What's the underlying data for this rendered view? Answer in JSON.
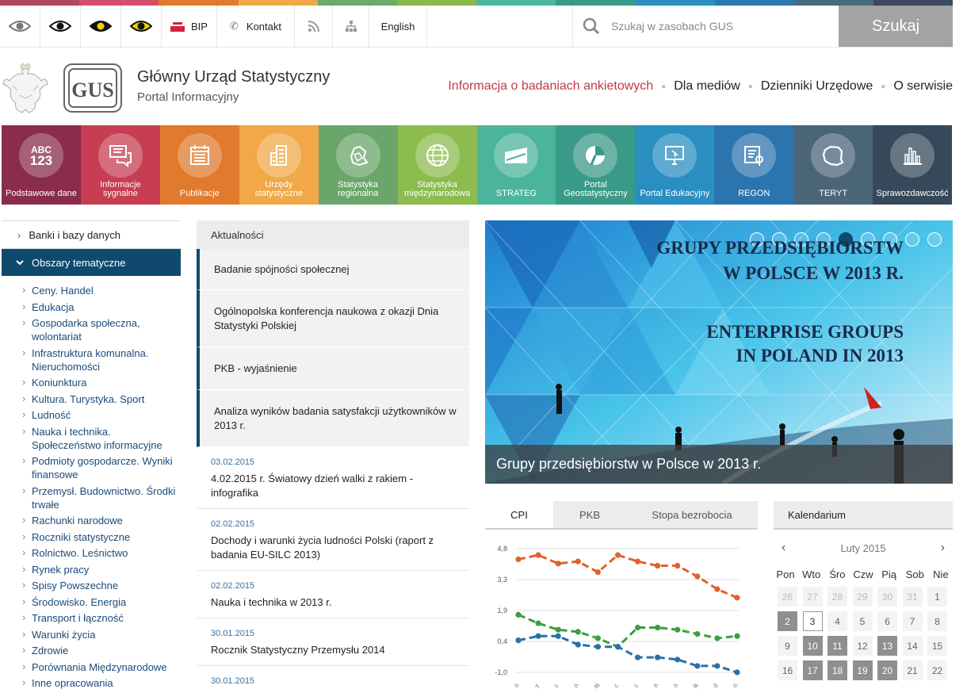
{
  "colors": {
    "strip": [
      "#b04a5a",
      "#d0506a",
      "#e07a2c",
      "#f0a84a",
      "#6aaa6a",
      "#8ab84a",
      "#4ab8a0",
      "#3a9a8a",
      "#2a90c0",
      "#2a78b0",
      "#4a6a80",
      "#3a4a5a"
    ],
    "tiles": [
      "#8a2d4a",
      "#c73e52",
      "#e07a2c",
      "#f0a848",
      "#6aa66a",
      "#8cbb4e",
      "#4bb49c",
      "#3a9a88",
      "#2a8ec0",
      "#2c74ae",
      "#4a6578",
      "#35495a"
    ],
    "accent_red": "#c0394a",
    "nav_blue": "#0f4a6e",
    "cpi": "#e0622a",
    "series2": "#3aa040",
    "series3": "#2a70a8"
  },
  "topbar": {
    "bip_label": "BIP",
    "kontakt_label": "Kontakt",
    "english_label": "English",
    "search_placeholder": "Szukaj w zasobach GUS",
    "search_button": "Szukaj"
  },
  "header": {
    "logo_text": "GUS",
    "title": "Główny Urząd Statystyczny",
    "subtitle": "Portal Informacyjny",
    "nav": [
      "Informacja o badaniach ankietowych",
      "Dla mediów",
      "Dzienniki Urzędowe",
      "O serwisie"
    ]
  },
  "tiles": [
    {
      "label": "Podstawowe dane",
      "icon": "abc-123-icon"
    },
    {
      "label": "Informacje sygnalne",
      "icon": "chat-icon"
    },
    {
      "label": "Publikacje",
      "icon": "calendar-icon"
    },
    {
      "label": "Urzędy statystyczne",
      "icon": "buildings-icon"
    },
    {
      "label": "Statystyka regionalna",
      "icon": "region-map-icon"
    },
    {
      "label": "Statystyka międzynarodowa",
      "icon": "globe-icon"
    },
    {
      "label": "STRATEG",
      "icon": "strateg-icon"
    },
    {
      "label": "Portal Geostatystyczny",
      "icon": "geo-icon"
    },
    {
      "label": "Portal Edukacyjny",
      "icon": "monitor-icon"
    },
    {
      "label": "REGON",
      "icon": "regon-icon"
    },
    {
      "label": "TERYT",
      "icon": "poland-map-icon"
    },
    {
      "label": "Sprawozdawczość",
      "icon": "bar-chart-icon"
    }
  ],
  "tile_abc": "ABC",
  "tile_123": "123",
  "sidebar": {
    "banki": "Banki i bazy danych",
    "obszary": "Obszary tematyczne",
    "items": [
      "Ceny. Handel",
      "Edukacja",
      "Gospodarka społeczna, wolontariat",
      "Infrastruktura komunalna. Nieruchomości",
      "Koniunktura",
      "Kultura. Turystyka. Sport",
      "Ludność",
      "Nauka i technika. Społeczeństwo informacyjne",
      "Podmioty gospodarcze. Wyniki finansowe",
      "Przemysł. Budownictwo. Środki trwałe",
      "Rachunki narodowe",
      "Roczniki statystyczne",
      "Rolnictwo. Leśnictwo",
      "Rynek pracy",
      "Spisy Powszechne",
      "Środowisko. Energia",
      "Transport i łączność",
      "Warunki życia",
      "Zdrowie",
      "Porównania Międzynarodowe",
      "Inne opracowania"
    ]
  },
  "news": {
    "header": "Aktualności",
    "featured": [
      "Badanie spójności społecznej",
      "Ogólnopolska konferencja naukowa z okazji Dnia Statystyki Polskiej",
      "PKB - wyjaśnienie",
      "Analiza wyników badania satysfakcji użytkowników w 2013 r."
    ],
    "items": [
      {
        "date": "03.02.2015",
        "text": "4.02.2015 r. Światowy dzień walki z rakiem - infografika"
      },
      {
        "date": "02.02.2015",
        "text": "Dochody i warunki życia ludności Polski (raport z badania EU-SILC 2013)"
      },
      {
        "date": "02.02.2015",
        "text": "Nauka i technika w 2013 r."
      },
      {
        "date": "30.01.2015",
        "text": "Rocznik Statystyczny Przemysłu 2014"
      },
      {
        "date": "30.01.2015",
        "text": ""
      }
    ]
  },
  "banner": {
    "pl_line1": "GRUPY PRZEDSIĘBIORSTW",
    "pl_line2": "W POLSCE W 2013 R.",
    "en_line1": "ENTERPRISE GROUPS",
    "en_line2": "IN POLAND IN 2013",
    "caption": "Grupy przedsiębiorstw w Polsce w 2013 r.",
    "slide_count": 9,
    "active_slide": 5
  },
  "chart_tabs": [
    "CPI",
    "PKB",
    "Stopa bezrobocia"
  ],
  "chart_data": {
    "type": "line",
    "y_ticks": [
      "4,8",
      "3,3",
      "1,9",
      "0,4",
      "-1,0"
    ],
    "ylim": [
      -1.0,
      4.8
    ],
    "x_count": 14,
    "x_tick_labels": [
      "ń",
      "y",
      "c",
      "ń",
      "aj",
      "c",
      "c",
      "ń",
      "ń",
      "ik",
      "d",
      "ń"
    ],
    "series": [
      {
        "color": "#e0622a",
        "values": [
          4.3,
          4.5,
          4.1,
          4.2,
          3.7,
          4.5,
          4.2,
          4.0,
          4.0,
          3.5,
          2.9,
          2.5
        ]
      },
      {
        "color": "#3aa040",
        "values": [
          1.7,
          1.3,
          1.0,
          0.9,
          0.6,
          0.2,
          1.1,
          1.1,
          1.0,
          0.8,
          0.6,
          0.7
        ]
      },
      {
        "color": "#2a70a8",
        "values": [
          0.5,
          0.7,
          0.7,
          0.3,
          0.2,
          0.2,
          -0.3,
          -0.3,
          -0.4,
          -0.7,
          -0.7,
          -1.0
        ]
      }
    ]
  },
  "calendar": {
    "header": "Kalendarium",
    "month": "Luty 2015",
    "prev": "‹",
    "next": "›",
    "days": [
      "Pon",
      "Wto",
      "Śro",
      "Czw",
      "Pią",
      "Sob",
      "Nie"
    ],
    "cells": [
      {
        "d": "26",
        "s": "muted"
      },
      {
        "d": "27",
        "s": "muted"
      },
      {
        "d": "28",
        "s": "muted"
      },
      {
        "d": "29",
        "s": "muted"
      },
      {
        "d": "30",
        "s": "muted"
      },
      {
        "d": "31",
        "s": "muted"
      },
      {
        "d": "1",
        "s": ""
      },
      {
        "d": "2",
        "s": "event"
      },
      {
        "d": "3",
        "s": "today"
      },
      {
        "d": "4",
        "s": ""
      },
      {
        "d": "5",
        "s": ""
      },
      {
        "d": "6",
        "s": ""
      },
      {
        "d": "7",
        "s": ""
      },
      {
        "d": "8",
        "s": ""
      },
      {
        "d": "9",
        "s": ""
      },
      {
        "d": "10",
        "s": "event"
      },
      {
        "d": "11",
        "s": "event"
      },
      {
        "d": "12",
        "s": ""
      },
      {
        "d": "13",
        "s": "event"
      },
      {
        "d": "14",
        "s": ""
      },
      {
        "d": "15",
        "s": ""
      },
      {
        "d": "16",
        "s": ""
      },
      {
        "d": "17",
        "s": "event"
      },
      {
        "d": "18",
        "s": "event"
      },
      {
        "d": "19",
        "s": "event"
      },
      {
        "d": "20",
        "s": "event"
      },
      {
        "d": "21",
        "s": ""
      },
      {
        "d": "22",
        "s": ""
      }
    ]
  }
}
